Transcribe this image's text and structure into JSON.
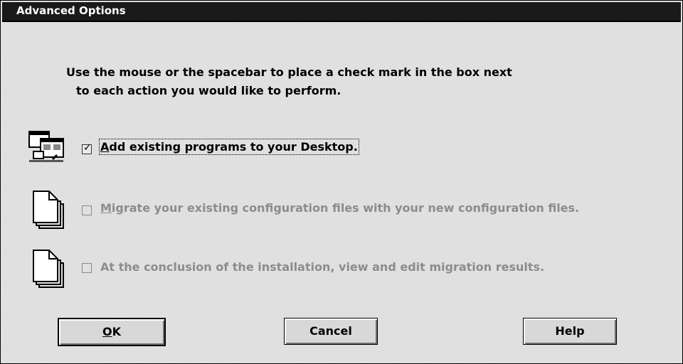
{
  "window": {
    "title": "Advanced Options"
  },
  "instructions": {
    "line1": "Use the mouse or the spacebar to place a check mark in the box next",
    "line2": "to each action you would like to perform."
  },
  "options": [
    {
      "mnemonic": "A",
      "rest": "dd existing programs to your Desktop.",
      "checked": true,
      "enabled": true,
      "icon": "desktop-programs-icon"
    },
    {
      "mnemonic": "M",
      "rest": "igrate your existing configuration files with your new configuration files.",
      "checked": false,
      "enabled": false,
      "icon": "document-icon"
    },
    {
      "mnemonic": "",
      "rest": "At the conclusion of the installation,  view and edit migration results.",
      "checked": false,
      "enabled": false,
      "icon": "document-icon"
    }
  ],
  "buttons": {
    "ok_mnemonic": "O",
    "ok_rest": "K",
    "cancel": "Cancel",
    "help": "Help"
  },
  "checkmark_glyph": "✓"
}
